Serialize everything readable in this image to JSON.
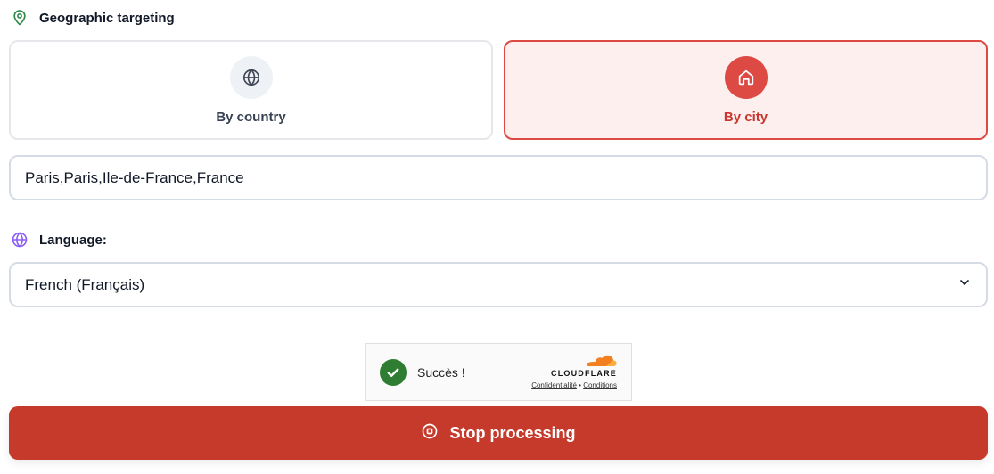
{
  "geo": {
    "heading": "Geographic targeting",
    "icon": "map-pin-icon",
    "modes": [
      {
        "label": "By country",
        "icon": "globe-icon",
        "selected": false
      },
      {
        "label": "By city",
        "icon": "home-icon",
        "selected": true
      }
    ],
    "city_value": "Paris,Paris,Ile-de-France,France"
  },
  "language": {
    "heading": "Language:",
    "icon": "globe-icon",
    "selected": "French (Français)"
  },
  "captcha": {
    "status": "Succès !",
    "brand": "CLOUDFLARE",
    "privacy_link": "Confidentialité",
    "separator": "•",
    "terms_link": "Conditions"
  },
  "actions": {
    "stop_label": "Stop processing"
  },
  "colors": {
    "accent": "#dc4a43",
    "accent_bg": "#fcefee",
    "button": "#c53a2b",
    "success": "#2f7d32",
    "pin": "#2f8a4a",
    "lang_icon": "#8b5cf6",
    "cloudflare": "#f38020"
  }
}
